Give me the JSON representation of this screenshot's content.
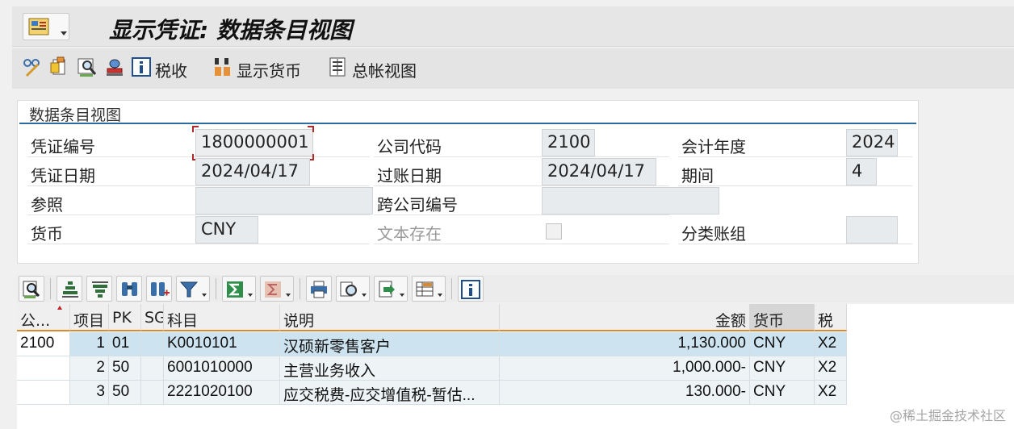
{
  "title": "显示凭证: 数据条目视图",
  "toolbar": {
    "tax_label": "税收",
    "currency_label": "显示货币",
    "ledger_label": "总帐视图"
  },
  "panel": {
    "title": "数据条目视图",
    "doc_no_label": "凭证编号",
    "doc_no": "1800000001",
    "company_label": "公司代码",
    "company": "2100",
    "fiscal_year_label": "会计年度",
    "fiscal_year": "2024",
    "doc_date_label": "凭证日期",
    "doc_date": "2024/04/17",
    "posting_date_label": "过账日期",
    "posting_date": "2024/04/17",
    "period_label": "期间",
    "period": "4",
    "reference_label": "参照",
    "reference": "",
    "cross_company_label": "跨公司编号",
    "cross_company": "",
    "currency_label": "货币",
    "currency": "CNY",
    "text_exists_label": "文本存在",
    "ledger_group_label": "分类账组",
    "ledger_group": ""
  },
  "grid": {
    "headers": {
      "company": "公...",
      "item": "项目",
      "pk": "PK",
      "sg": "SG",
      "account": "科目",
      "description": "说明",
      "amount": "金额",
      "currency": "货币",
      "tax": "税"
    },
    "rows": [
      {
        "company": "2100",
        "item": "1",
        "pk": "01",
        "sg": "",
        "account": "K0010101",
        "description": "汉硕新零售客户",
        "amount": "1,130.000",
        "currency": "CNY",
        "tax": "X2"
      },
      {
        "company": "",
        "item": "2",
        "pk": "50",
        "sg": "",
        "account": "6001010000",
        "description": "主营业务收入",
        "amount": "1,000.000-",
        "currency": "CNY",
        "tax": "X2"
      },
      {
        "company": "",
        "item": "3",
        "pk": "50",
        "sg": "",
        "account": "2221020100",
        "description": "应交税费-应交增值税-暂估...",
        "amount": "130.000-",
        "currency": "CNY",
        "tax": "X2"
      }
    ]
  },
  "watermark": "@稀土掘金技术社区"
}
